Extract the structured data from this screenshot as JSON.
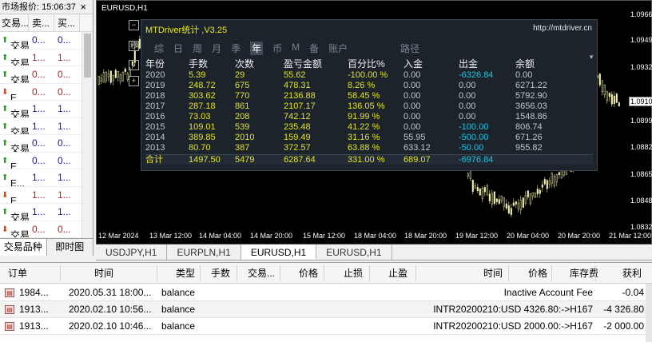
{
  "market_watch": {
    "title": "市场报价: 15:06:37",
    "columns": [
      "交易...",
      "卖...",
      "买..."
    ],
    "rows": [
      {
        "dir": "up",
        "symbol": "交易...",
        "bid": "0...",
        "ask": "0...",
        "bid_color": "blue",
        "ask_color": "blue"
      },
      {
        "dir": "up",
        "symbol": "交易...",
        "bid": "1...",
        "ask": "1...",
        "bid_color": "red",
        "ask_color": "red"
      },
      {
        "dir": "up",
        "symbol": "交易...",
        "bid": "0...",
        "ask": "0...",
        "bid_color": "red",
        "ask_color": "red"
      },
      {
        "dir": "down",
        "symbol": "E...",
        "bid": "0...",
        "ask": "0...",
        "bid_color": "red",
        "ask_color": "red"
      },
      {
        "dir": "up",
        "symbol": "交易...",
        "bid": "1...",
        "ask": "1...",
        "bid_color": "blue",
        "ask_color": "blue"
      },
      {
        "dir": "up",
        "symbol": "交易...",
        "bid": "1...",
        "ask": "1...",
        "bid_color": "blue",
        "ask_color": "blue"
      },
      {
        "dir": "up",
        "symbol": "交易...",
        "bid": "0...",
        "ask": "0...",
        "bid_color": "blue",
        "ask_color": "blue"
      },
      {
        "dir": "up",
        "symbol": "E...",
        "bid": "0...",
        "ask": "0...",
        "bid_color": "blue",
        "ask_color": "blue"
      },
      {
        "dir": "up",
        "symbol": "E...",
        "bid": "1...",
        "ask": "1...",
        "bid_color": "blue",
        "ask_color": "blue"
      },
      {
        "dir": "down",
        "symbol": "E...",
        "bid": "1...",
        "ask": "1...",
        "bid_color": "red",
        "ask_color": "red"
      },
      {
        "dir": "up",
        "symbol": "交易...",
        "bid": "1...",
        "ask": "1...",
        "bid_color": "blue",
        "ask_color": "blue"
      },
      {
        "dir": "down",
        "symbol": "交易...",
        "bid": "0...",
        "ask": "0...",
        "bid_color": "red",
        "ask_color": "red"
      }
    ],
    "tabs": [
      "交易品种",
      "即时图"
    ]
  },
  "chart": {
    "title": "EURUSD,H1",
    "y_labels": [
      "1.0966",
      "1.0949",
      "1.0932",
      "1.0910",
      "1.0899",
      "1.0882",
      "1.0865",
      "1.0848",
      "1.0832"
    ],
    "current_price": "1.0910",
    "x_labels": [
      "12 Mar 2024",
      "13 Mar 12:00",
      "14 Mar 04:00",
      "14 Mar 20:00",
      "15 Mar 12:00",
      "18 Mar 04:00",
      "18 Mar 20:00",
      "19 Mar 12:00",
      "20 Mar 04:00",
      "20 Mar 20:00",
      "21 Mar 12:00"
    ],
    "toolbar_icons": [
      "minus-box-icon",
      "move-icon",
      "check-box-icon",
      "plus-box-icon"
    ]
  },
  "stats": {
    "title": "MTDriver统计 ,V3.25",
    "url": "http://mtdriver.cn",
    "tabs": [
      "综",
      "日",
      "周",
      "月",
      "季",
      "年",
      "币",
      "M",
      "备",
      "账户",
      "路径"
    ],
    "active_tab": "年",
    "headers": [
      "年份",
      "手数",
      "次数",
      "盈亏金额",
      "百分比%",
      "入金",
      "出金",
      "余额"
    ],
    "rows": [
      [
        "2020",
        "5.39",
        "29",
        "55.62",
        "-100.00 %",
        "0.00",
        "-6326.84",
        "0.00"
      ],
      [
        "2019",
        "248.72",
        "675",
        "478.31",
        "8.26 %",
        "0.00",
        "0.00",
        "6271.22"
      ],
      [
        "2018",
        "303.62",
        "770",
        "2136.88",
        "58.45 %",
        "0.00",
        "0.00",
        "5792.90"
      ],
      [
        "2017",
        "287.18",
        "861",
        "2107.17",
        "136.05 %",
        "0.00",
        "0.00",
        "3656.03"
      ],
      [
        "2016",
        "73.03",
        "208",
        "742.12",
        "91.99 %",
        "0.00",
        "0.00",
        "1548.86"
      ],
      [
        "2015",
        "109.01",
        "539",
        "235.48",
        "41.22 %",
        "0.00",
        "-100.00",
        "806.74"
      ],
      [
        "2014",
        "389.85",
        "2010",
        "159.49",
        "31.16 %",
        "55.95",
        "-500.00",
        "671.26"
      ],
      [
        "2013",
        "80.70",
        "387",
        "372.57",
        "63.88 %",
        "633.12",
        "-50.00",
        "955.82"
      ]
    ],
    "total": [
      "合计",
      "1497.50",
      "5479",
      "6287.64",
      "331.00 %",
      "689.07",
      "-6976.84",
      ""
    ]
  },
  "chart_tabs": [
    "USDJPY,H1",
    "EURPLN,H1",
    "EURUSD,H1",
    "EURUSD,H1"
  ],
  "active_chart_tab": "EURUSD,H1",
  "terminal": {
    "columns": [
      "订单",
      "时间",
      "类型",
      "手数",
      "交易...",
      "价格",
      "止损",
      "止盈",
      "时间",
      "价格",
      "库存费",
      "获利"
    ],
    "rows": [
      {
        "order": "1984...",
        "time": "2020.05.31 18:00...",
        "type": "balance",
        "comment": "Inactive Account Fee",
        "profit": "-0.04"
      },
      {
        "order": "1913...",
        "time": "2020.02.10 10:56...",
        "type": "balance",
        "comment": "INTR20200210:USD 4326.80:->H167",
        "profit": "-4 326.80"
      },
      {
        "order": "1913...",
        "time": "2020.02.10 10:46...",
        "type": "balance",
        "comment": "INTR20200210:USD 2000.00:->H167",
        "profit": "-2 000.00"
      }
    ]
  }
}
